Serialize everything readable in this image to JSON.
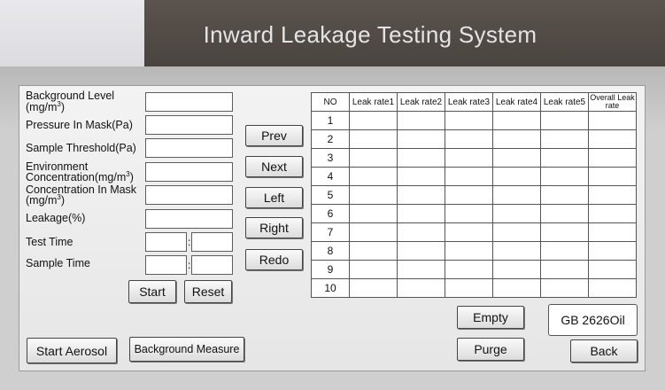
{
  "header": {
    "title": "Inward Leakage Testing System"
  },
  "form": {
    "background_level": {
      "line1": "Background Level",
      "line2": "(mg/m",
      "sup": "3",
      "close": ")"
    },
    "pressure_in_mask": "Pressure In Mask(Pa)",
    "sample_threshold": "Sample Threshold(Pa)",
    "environment_concentration": {
      "line1": "Environment",
      "line2": "Concentration(mg/m",
      "sup": "3",
      "close": ")"
    },
    "concentration_in_mask": {
      "line1": "Concentration In Mask",
      "line2": "(mg/m",
      "sup": "3",
      "close": ")"
    },
    "leakage": "Leakage(%)",
    "test_time": "Test Time",
    "sample_time": "Sample Time",
    "colon": ":"
  },
  "buttons": {
    "start": "Start",
    "reset": "Reset",
    "prev": "Prev",
    "next": "Next",
    "left": "Left",
    "right": "Right",
    "redo": "Redo",
    "start_aerosol": "Start Aerosol",
    "background_measure": "Background Measure",
    "empty": "Empty",
    "purge": "Purge",
    "back": "Back"
  },
  "standard_label": "GB 2626Oil",
  "table": {
    "headers": [
      "NO",
      "Leak rate1",
      "Leak rate2",
      "Leak rate3",
      "Leak rate4",
      "Leak rate5",
      "Overall Leak rate"
    ],
    "rows": [
      "1",
      "2",
      "3",
      "4",
      "5",
      "6",
      "7",
      "8",
      "9",
      "10"
    ]
  }
}
